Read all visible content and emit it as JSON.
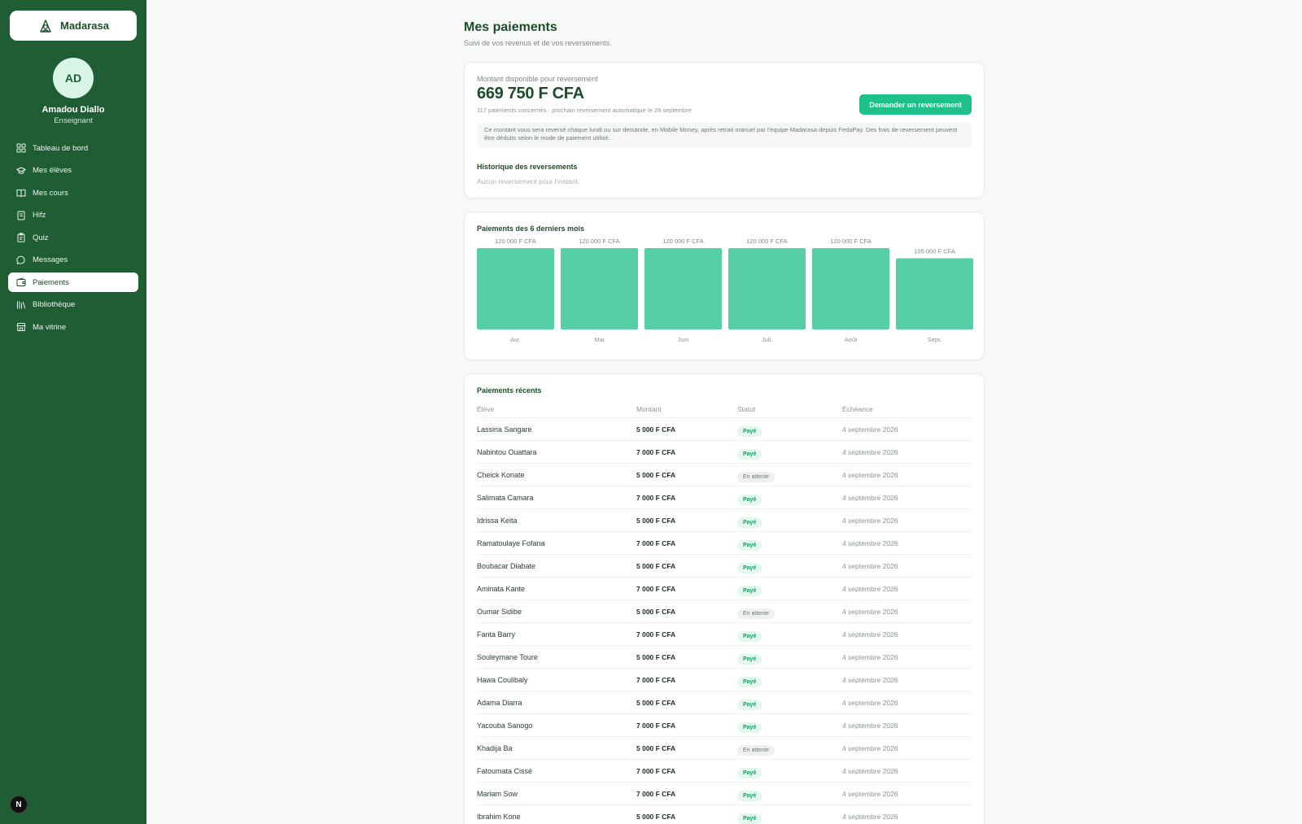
{
  "brand": {
    "name": "Madarasa"
  },
  "user": {
    "initials": "AD",
    "name": "Amadou Diallo",
    "role": "Enseignant"
  },
  "nav": [
    {
      "label": "Tableau de bord",
      "icon": "dashboard-icon",
      "active": false
    },
    {
      "label": "Mes élèves",
      "icon": "graduation-cap-icon",
      "active": false
    },
    {
      "label": "Mes cours",
      "icon": "book-open-icon",
      "active": false
    },
    {
      "label": "Hifz",
      "icon": "notebook-icon",
      "active": false
    },
    {
      "label": "Quiz",
      "icon": "clipboard-icon",
      "active": false
    },
    {
      "label": "Messages",
      "icon": "message-icon",
      "active": false
    },
    {
      "label": "Paiements",
      "icon": "wallet-icon",
      "active": true
    },
    {
      "label": "Bibliothèque",
      "icon": "library-icon",
      "active": false
    },
    {
      "label": "Ma vitrine",
      "icon": "store-icon",
      "active": false
    }
  ],
  "page": {
    "title": "Mes paiements",
    "subtitle": "Suivi de vos revenus et de vos reversements."
  },
  "balance": {
    "label": "Montant disponible pour reversement",
    "amount": "669 750 F CFA",
    "note": "117 paiements concernés · prochain reversement automatique le 28 septembre",
    "button": "Demander un reversement",
    "info": "Ce montant vous sera reversé chaque lundi ou sur demande, en Mobile Money, après retrait manuel par l'équipe Madarasa depuis FedaPay. Des frais de reversement peuvent être déduits selon le mode de paiement utilisé.",
    "history_title": "Historique des reversements",
    "history_empty": "Aucun reversement pour l'instant."
  },
  "chart_data": {
    "type": "bar",
    "title": "Paiements des 6 derniers mois",
    "categories": [
      "Avr.",
      "Mai",
      "Juin",
      "Juil.",
      "Août",
      "Sept."
    ],
    "values": [
      120000,
      120000,
      120000,
      120000,
      120000,
      105000
    ],
    "value_labels": [
      "120 000 F CFA",
      "120 000 F CFA",
      "120 000 F CFA",
      "120 000 F CFA",
      "120 000 F CFA",
      "105 000 F CFA"
    ],
    "ylim": [
      0,
      120000
    ],
    "bar_color": "#56cfa4",
    "grid": false
  },
  "payments": {
    "title": "Paiements récents",
    "headers": [
      "Élève",
      "Montant",
      "Statut",
      "Échéance"
    ],
    "rows": [
      {
        "name": "Lassina Sangare",
        "amount": "5 000 F CFA",
        "status": "Payé",
        "due": "4 septembre 2026"
      },
      {
        "name": "Nabintou Ouattara",
        "amount": "7 000 F CFA",
        "status": "Payé",
        "due": "4 septembre 2026"
      },
      {
        "name": "Cheick Konate",
        "amount": "5 000 F CFA",
        "status": "En attente",
        "due": "4 septembre 2026"
      },
      {
        "name": "Salimata Camara",
        "amount": "7 000 F CFA",
        "status": "Payé",
        "due": "4 septembre 2026"
      },
      {
        "name": "Idrissa Keita",
        "amount": "5 000 F CFA",
        "status": "Payé",
        "due": "4 septembre 2026"
      },
      {
        "name": "Ramatoulaye Fofana",
        "amount": "7 000 F CFA",
        "status": "Payé",
        "due": "4 septembre 2026"
      },
      {
        "name": "Boubacar Diabate",
        "amount": "5 000 F CFA",
        "status": "Payé",
        "due": "4 septembre 2026"
      },
      {
        "name": "Aminata Kante",
        "amount": "7 000 F CFA",
        "status": "Payé",
        "due": "4 septembre 2026"
      },
      {
        "name": "Oumar Sidibe",
        "amount": "5 000 F CFA",
        "status": "En attente",
        "due": "4 septembre 2026"
      },
      {
        "name": "Fanta Barry",
        "amount": "7 000 F CFA",
        "status": "Payé",
        "due": "4 septembre 2026"
      },
      {
        "name": "Souleymane Toure",
        "amount": "5 000 F CFA",
        "status": "Payé",
        "due": "4 septembre 2026"
      },
      {
        "name": "Hawa Coulibaly",
        "amount": "7 000 F CFA",
        "status": "Payé",
        "due": "4 septembre 2026"
      },
      {
        "name": "Adama Diarra",
        "amount": "5 000 F CFA",
        "status": "Payé",
        "due": "4 septembre 2026"
      },
      {
        "name": "Yacouba Sanogo",
        "amount": "7 000 F CFA",
        "status": "Payé",
        "due": "4 septembre 2026"
      },
      {
        "name": "Khadija Ba",
        "amount": "5 000 F CFA",
        "status": "En attente",
        "due": "4 septembre 2026"
      },
      {
        "name": "Fatoumata Cissé",
        "amount": "7 000 F CFA",
        "status": "Payé",
        "due": "4 septembre 2026"
      },
      {
        "name": "Mariam Sow",
        "amount": "7 000 F CFA",
        "status": "Payé",
        "due": "4 septembre 2026"
      },
      {
        "name": "Ibrahim Kone",
        "amount": "5 000 F CFA",
        "status": "Payé",
        "due": "4 septembre 2026"
      }
    ]
  },
  "dev_badge": "N"
}
